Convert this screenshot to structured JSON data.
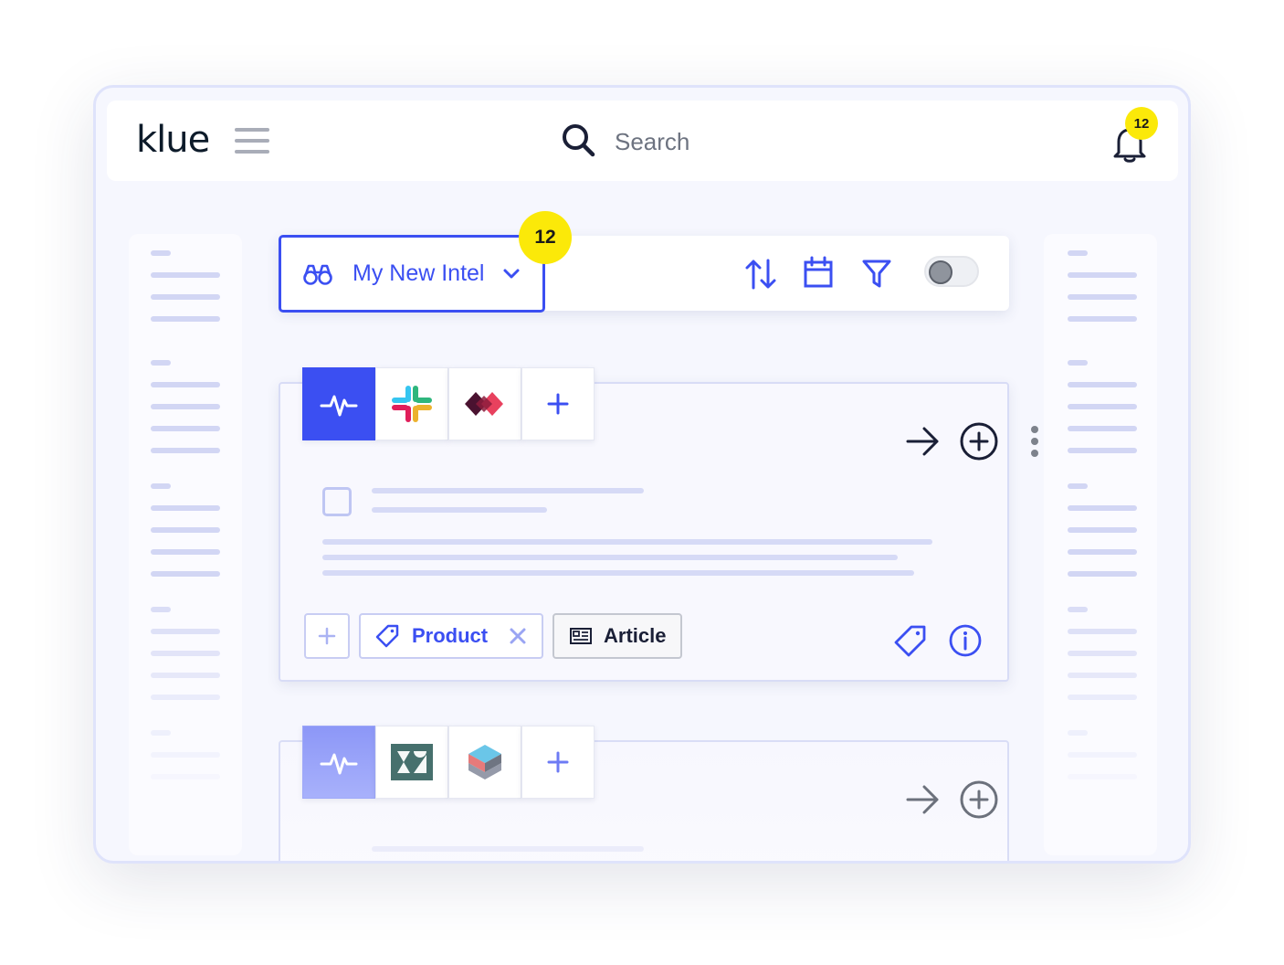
{
  "app": {
    "logo": "klue"
  },
  "search": {
    "placeholder": "Search"
  },
  "notifications": {
    "count": "12"
  },
  "feed": {
    "title": "My New Intel",
    "count": "12"
  },
  "toolbar": {
    "icons": [
      "sort-icon",
      "calendar-icon",
      "filter-icon"
    ],
    "toggle_on": false
  },
  "cards": [
    {
      "sources": [
        "pulse-icon",
        "slack-icon",
        "diamond-logo-icon",
        "plus-icon"
      ],
      "tags": [
        {
          "label": "Product",
          "removable": true
        },
        {
          "label": "Article",
          "type": "article"
        }
      ]
    },
    {
      "sources": [
        "pulse-icon",
        "zendesk-icon",
        "layered-logo-icon",
        "plus-icon"
      ]
    }
  ],
  "colors": {
    "accent": "#3b4ff2",
    "badge": "#fbe909",
    "text_dark": "#1a1f36",
    "skeleton": "#d6daf6"
  }
}
